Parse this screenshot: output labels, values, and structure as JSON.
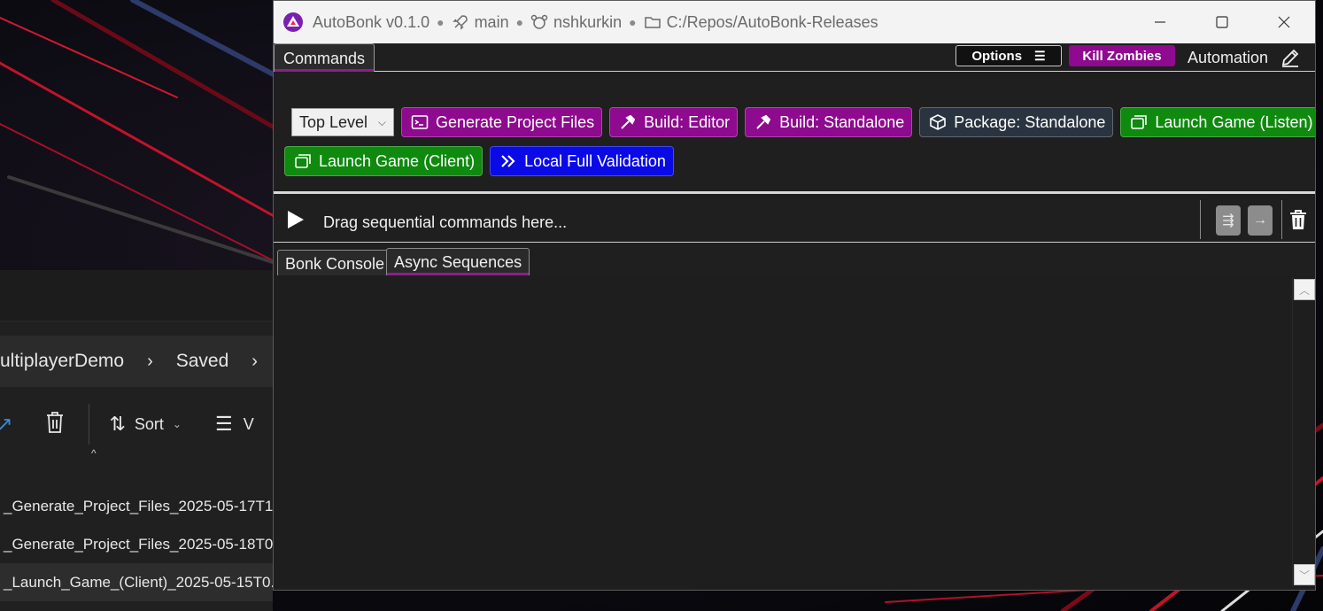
{
  "app": {
    "title": "AutoBonk v0.1.0",
    "branch": "main",
    "user": "nshkurkin",
    "path": "C:/Repos/AutoBonk-Releases"
  },
  "menubar": {
    "commands_tab": "Commands",
    "options_label": "Options",
    "kill_label": "Kill Zombies",
    "automation_label": "Automation"
  },
  "commands": {
    "scope_select": "Top Level",
    "buttons": [
      {
        "label": "Generate Project Files",
        "color": "#8e0a8e",
        "icon": "terminal-icon"
      },
      {
        "label": "Build: Editor",
        "color": "#8e0a8e",
        "icon": "hammer-icon"
      },
      {
        "label": "Build: Standalone",
        "color": "#8e0a8e",
        "icon": "hammer-icon"
      },
      {
        "label": "Package: Standalone",
        "color": "#2a3440",
        "icon": "package-icon"
      },
      {
        "label": "Launch Game (Listen)",
        "color": "#0f8a0f",
        "icon": "windows-icon"
      },
      {
        "label": "Launch Game (Client)",
        "color": "#0f8a0f",
        "icon": "windows-icon"
      },
      {
        "label": "Local Full Validation",
        "color": "#0a0ae6",
        "icon": "double-chevron-icon"
      }
    ]
  },
  "sequence": {
    "hint": "Drag sequential commands here..."
  },
  "lower_tabs": [
    "Bonk Console",
    "Async Sequences"
  ],
  "explorer": {
    "breadcrumb": [
      "ultiplayerDemo",
      "Saved"
    ],
    "sort_label": "Sort",
    "view_label": "V",
    "files": [
      "_Generate_Project_Files_2025-05-17T1...",
      "_Generate_Project_Files_2025-05-18T0...",
      "_Launch_Game_(Client)_2025-05-15T0..."
    ]
  }
}
